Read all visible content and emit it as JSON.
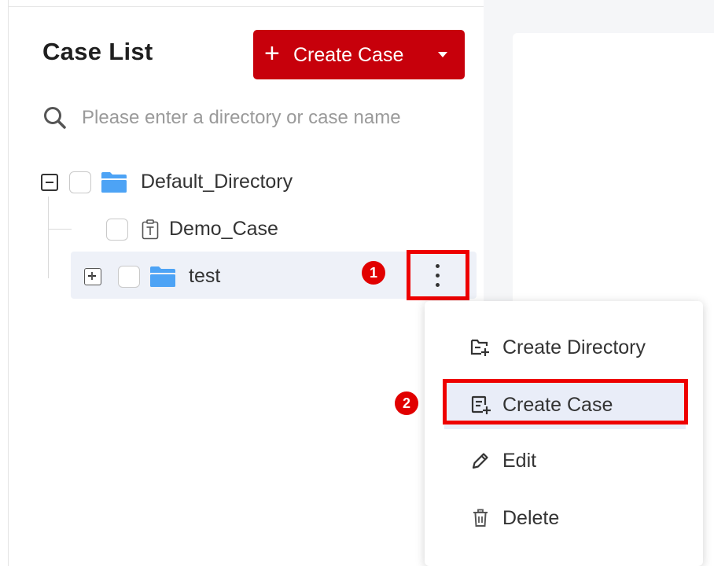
{
  "header": {
    "title": "Case List",
    "create_button": {
      "plus": "+",
      "label": "Create Case"
    }
  },
  "search": {
    "placeholder": "Please enter a directory or case name"
  },
  "tree": {
    "root": {
      "label": "Default_Directory"
    },
    "children": [
      {
        "label": "Demo_Case"
      },
      {
        "label": "test"
      }
    ]
  },
  "callouts": {
    "step1": "1",
    "step2": "2"
  },
  "context_menu": {
    "items": [
      {
        "label": "Create Directory",
        "icon": "create-directory-icon"
      },
      {
        "label": "Create Case",
        "icon": "create-case-icon"
      },
      {
        "label": "Edit",
        "icon": "edit-icon"
      },
      {
        "label": "Delete",
        "icon": "delete-icon"
      }
    ]
  },
  "colors": {
    "brand_red": "#c7000b",
    "annotation_red": "#ee0000",
    "folder_blue": "#4da3f5",
    "highlight": "#eef1f8"
  }
}
